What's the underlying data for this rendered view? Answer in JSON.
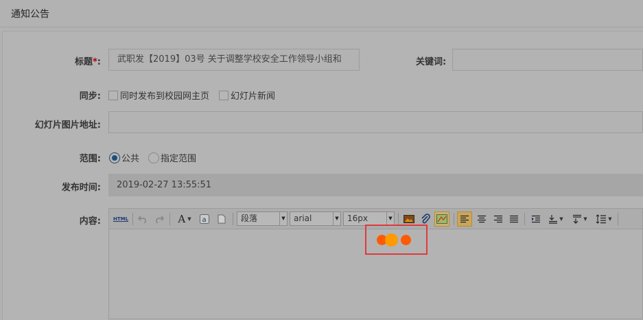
{
  "header": {
    "title": "通知公告"
  },
  "form": {
    "title_label": "标题",
    "title_required": "*",
    "title_suffix": ":",
    "title_value": "武职发【2019】03号 关于调整学校安全工作领导小组和",
    "keywords_label": "关键词:",
    "keywords_value": "",
    "sync_label": "同步:",
    "sync_options": [
      {
        "label": "同时发布到校园网主页",
        "checked": false
      },
      {
        "label": "幻灯片新闻",
        "checked": false
      }
    ],
    "slide_url_label": "幻灯片图片地址:",
    "slide_url_value": "",
    "scope_label": "范围:",
    "scope_options": [
      {
        "label": "公共",
        "selected": true
      },
      {
        "label": "指定范围",
        "selected": false
      }
    ],
    "publish_time_label": "发布时间:",
    "publish_time_value": "2019-02-27 13:55:51",
    "content_label": "内容:"
  },
  "editor": {
    "html_button": "HTML",
    "font_color_glyph": "A",
    "paragraph_select": "段落",
    "font_family_select": "arial",
    "font_size_select": "16px",
    "loader_colors": [
      "#ff5a00",
      "#ff9a00",
      "#ff5a00"
    ]
  }
}
